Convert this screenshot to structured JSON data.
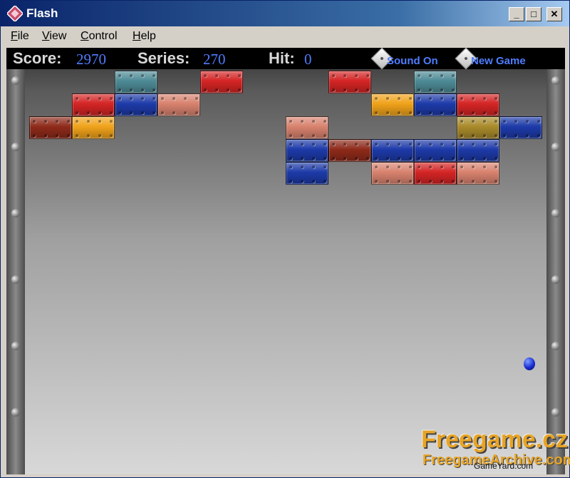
{
  "window": {
    "title": "Flash",
    "controls": [
      "_",
      "□",
      "✕"
    ]
  },
  "menu": [
    "File",
    "View",
    "Control",
    "Help"
  ],
  "hud": {
    "score_label": "Score:",
    "score_value": "2970",
    "series_label": "Series:",
    "series_value": "270",
    "hit_label": "Hit:",
    "hit_value": "0",
    "sound_button": "Sound On",
    "new_game_button": "New Game"
  },
  "colors": {
    "red": "#d42424",
    "blue": "#1d3aa8",
    "teal": "#4d8a96",
    "salmon": "#d8826e",
    "orange": "#f0a21a",
    "darkred": "#8e2a1a",
    "olive": "#a98a2a",
    "score_text": "#4f7dff"
  },
  "bricks": [
    {
      "col": 3,
      "row": 0,
      "color": "teal"
    },
    {
      "col": 5,
      "row": 0,
      "color": "red"
    },
    {
      "col": 8,
      "row": 0,
      "color": "red"
    },
    {
      "col": 10,
      "row": 0,
      "color": "teal"
    },
    {
      "col": 2,
      "row": 1,
      "color": "red"
    },
    {
      "col": 3,
      "row": 1,
      "color": "blue"
    },
    {
      "col": 4,
      "row": 1,
      "color": "salmon"
    },
    {
      "col": 9,
      "row": 1,
      "color": "orange"
    },
    {
      "col": 10,
      "row": 1,
      "color": "blue"
    },
    {
      "col": 11,
      "row": 1,
      "color": "red"
    },
    {
      "col": 1,
      "row": 2,
      "color": "darkred"
    },
    {
      "col": 2,
      "row": 2,
      "color": "orange"
    },
    {
      "col": 7,
      "row": 2,
      "color": "salmon"
    },
    {
      "col": 11,
      "row": 2,
      "color": "olive"
    },
    {
      "col": 12,
      "row": 2,
      "color": "blue"
    },
    {
      "col": 7,
      "row": 3,
      "color": "blue"
    },
    {
      "col": 8,
      "row": 3,
      "color": "darkred"
    },
    {
      "col": 9,
      "row": 3,
      "color": "blue"
    },
    {
      "col": 10,
      "row": 3,
      "color": "blue"
    },
    {
      "col": 11,
      "row": 3,
      "color": "blue"
    },
    {
      "col": 7,
      "row": 4,
      "color": "blue"
    },
    {
      "col": 9,
      "row": 4,
      "color": "salmon"
    },
    {
      "col": 10,
      "row": 4,
      "color": "red"
    },
    {
      "col": 11,
      "row": 4,
      "color": "salmon"
    }
  ],
  "watermark": {
    "line1": "Freegame.cz",
    "line2": "FreegameArchive.com",
    "line3": "GameYard.com"
  }
}
